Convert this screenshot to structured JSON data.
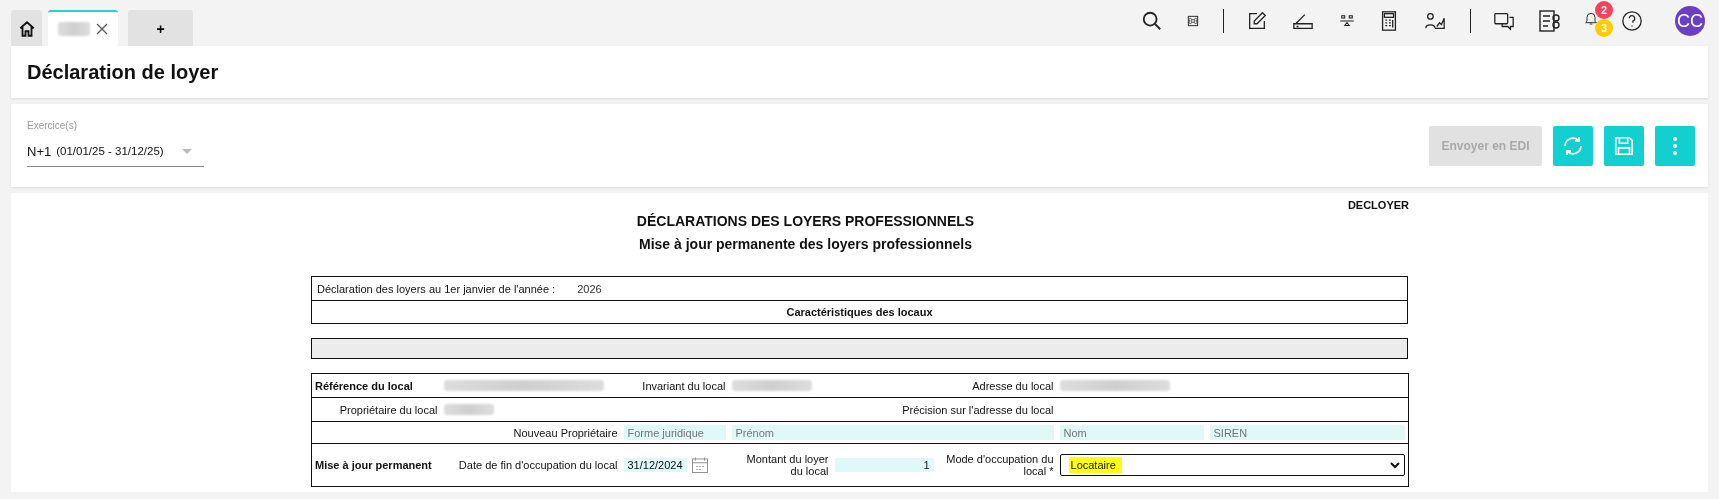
{
  "tabs": [
    {
      "kind": "home",
      "selected": false
    },
    {
      "kind": "document",
      "selected": true
    },
    {
      "kind": "add",
      "label": "+",
      "selected": false
    }
  ],
  "toolbar": {
    "badges": [
      {
        "count": "2",
        "color": "#f4425d"
      },
      {
        "count": "3",
        "color": "#ffcc00"
      }
    ],
    "avatar": "CC"
  },
  "page_title": "Déclaration de loyer",
  "filter": {
    "label": "Exercice(s)",
    "value": "N+1",
    "period": "(01/01/25 - 31/12/25)"
  },
  "actions": [
    {
      "kind": "text",
      "label": "Envoyer en EDI",
      "disabled": true
    },
    {
      "kind": "refresh",
      "disabled": false
    },
    {
      "kind": "save",
      "disabled": false
    },
    {
      "kind": "more",
      "disabled": false
    }
  ],
  "form": {
    "code": "DECLOYER",
    "title": "DÉCLARATIONS DES LOYERS PROFESSIONNELS",
    "subtitle": "Mise à jour permanente des loyers professionnels",
    "year_label": "Déclaration des loyers au 1er janvier de l'année :",
    "year": "2026",
    "section": "Caractéristiques des locaux",
    "reference_label": "Référence du local",
    "invariant_label": "Invariant du local",
    "address_label": "Adresse du local",
    "owner_label": "Propriétaire du local",
    "address_detail_label": "Précision sur l'adresse du local",
    "new_owner_label": "Nouveau Propriétaire",
    "new_owner_fields": [
      {
        "placeholder": "Forme juridique"
      },
      {
        "placeholder": "Prénom"
      },
      {
        "placeholder": "Nom"
      },
      {
        "placeholder": "SIREN"
      }
    ],
    "update_label": "Mise à jour permanent",
    "end_date_label": "Date de fin d'occupation du local",
    "end_date": "31/12/2024",
    "rent_label": "Montant du loyer du local",
    "rent": "1",
    "mode_label": "Mode d'occupation du local *",
    "mode": "Locataire"
  }
}
